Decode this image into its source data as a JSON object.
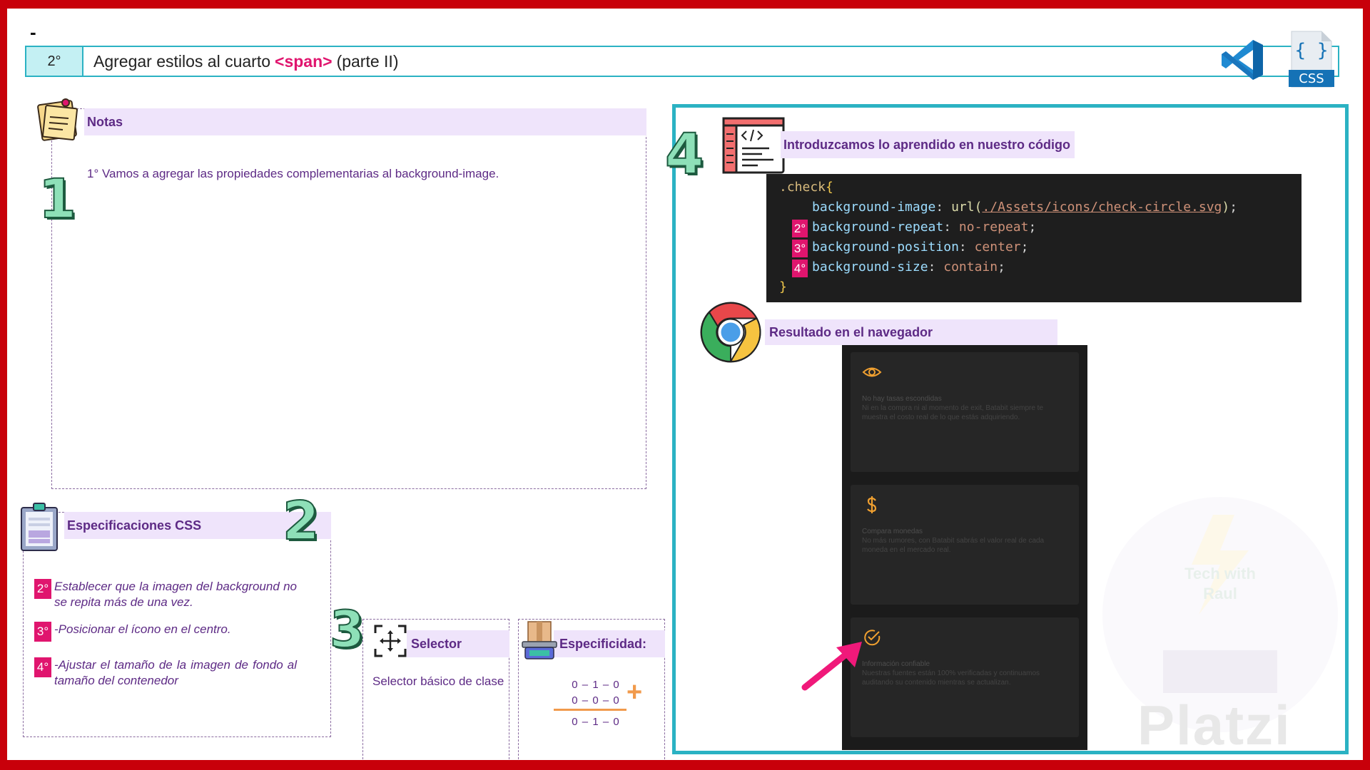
{
  "header": {
    "dash": "-",
    "step_number": "2°",
    "title_before": "Agregar estilos al cuarto",
    "title_tag": "<span>",
    "title_after": "(parte II)",
    "css_icon_label": "CSS",
    "css_icon_glyph": "{ }"
  },
  "notes": {
    "heading": "Notas",
    "text": "1° Vamos a agregar las propiedades complementarias al background-image.",
    "step_number": "1"
  },
  "specs": {
    "heading": "Especificaciones CSS",
    "step_number": "2",
    "items": [
      {
        "badge": "2°",
        "text": "Establecer que la imagen del background no se repita más de una vez."
      },
      {
        "badge": "3°",
        "text": "-Posicionar el ícono en el centro."
      },
      {
        "badge": "4°",
        "text": "-Ajustar el tamaño de la imagen de fondo al tamaño del contenedor"
      }
    ]
  },
  "selector": {
    "step_number": "3",
    "heading": "Selector",
    "text": "Selector básico de clase"
  },
  "specificity": {
    "heading": "Especificidad:",
    "rows": [
      "0 – 1 – 0",
      "0 – 0 – 0",
      "0 – 1 – 0"
    ],
    "plus": "+"
  },
  "code_section": {
    "step_number": "4",
    "heading": "Introduzcamos lo aprendido en nuestro código",
    "selector": ".check",
    "open_brace": "{",
    "close_brace": "}",
    "lines": [
      {
        "badge": "",
        "prop": "background-image",
        "fn": "url(",
        "val": "./Assets/icons/check-circle.svg",
        "fn_close": ")"
      },
      {
        "badge": "2°",
        "prop": "background-repeat",
        "val": "no-repeat"
      },
      {
        "badge": "3°",
        "prop": "background-position",
        "val": "center"
      },
      {
        "badge": "4°",
        "prop": "background-size",
        "val": "contain"
      }
    ]
  },
  "browser_section": {
    "heading": "Resultado en el navegador",
    "cards": [
      {
        "icon": "eye-icon",
        "title": "No hay tasas escondidas",
        "desc": "Ni en la compra ni al momento de exit, Batabit siempre te muestra el costo real de lo que estás adquiriendo."
      },
      {
        "icon": "dollar-icon",
        "title": "Compara monedas",
        "desc": "No más rumores, con Batabit sabrás el valor real de cada moneda en el mercado real."
      },
      {
        "icon": "check-circle-icon",
        "title": "Información confiable",
        "desc": "Nuestras fuentes están 100% verificadas y continuamos auditando su contenido mientras se actualizan."
      }
    ]
  },
  "watermark_text": [
    "Tech with",
    "Raul"
  ],
  "brand": "Platzi",
  "colors": {
    "frame": "#c8000a",
    "accent_teal": "#2bb2c3",
    "accent_pink": "#e0156e",
    "heading_purple": "#5d2a85",
    "heading_bg": "#efe4fb",
    "icon_orange": "#f0a030"
  }
}
